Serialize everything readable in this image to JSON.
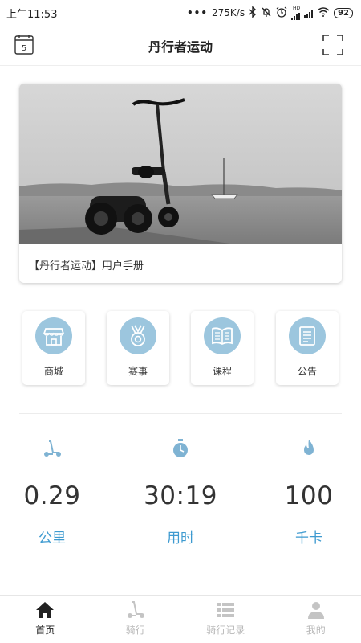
{
  "status_bar": {
    "time": "上午11:53",
    "speed": "275K/s",
    "hd_label": "HD",
    "battery": "92"
  },
  "header": {
    "title": "丹行者运动",
    "calendar_day": "5"
  },
  "banner": {
    "caption": "【丹行者运动】用户手册"
  },
  "menu": [
    {
      "label": "商城",
      "icon": "store-icon"
    },
    {
      "label": "赛事",
      "icon": "medal-icon"
    },
    {
      "label": "课程",
      "icon": "book-icon"
    },
    {
      "label": "公告",
      "icon": "notice-icon"
    }
  ],
  "stats": [
    {
      "value": "0.29",
      "unit": "公里",
      "icon": "scooter-icon"
    },
    {
      "value": "30:19",
      "unit": "用时",
      "icon": "stopwatch-icon"
    },
    {
      "value": "100",
      "unit": "千卡",
      "icon": "flame-icon"
    }
  ],
  "tabs": [
    {
      "label": "首页",
      "icon": "home-icon",
      "active": true
    },
    {
      "label": "骑行",
      "icon": "scooter-icon",
      "active": false
    },
    {
      "label": "骑行记录",
      "icon": "list-icon",
      "active": false
    },
    {
      "label": "我的",
      "icon": "user-icon",
      "active": false
    }
  ],
  "colors": {
    "accent": "#3d9ad0",
    "tile_icon_bg": "#9cc6de",
    "tab_inactive": "#b8b8b8",
    "tab_active": "#222222"
  }
}
